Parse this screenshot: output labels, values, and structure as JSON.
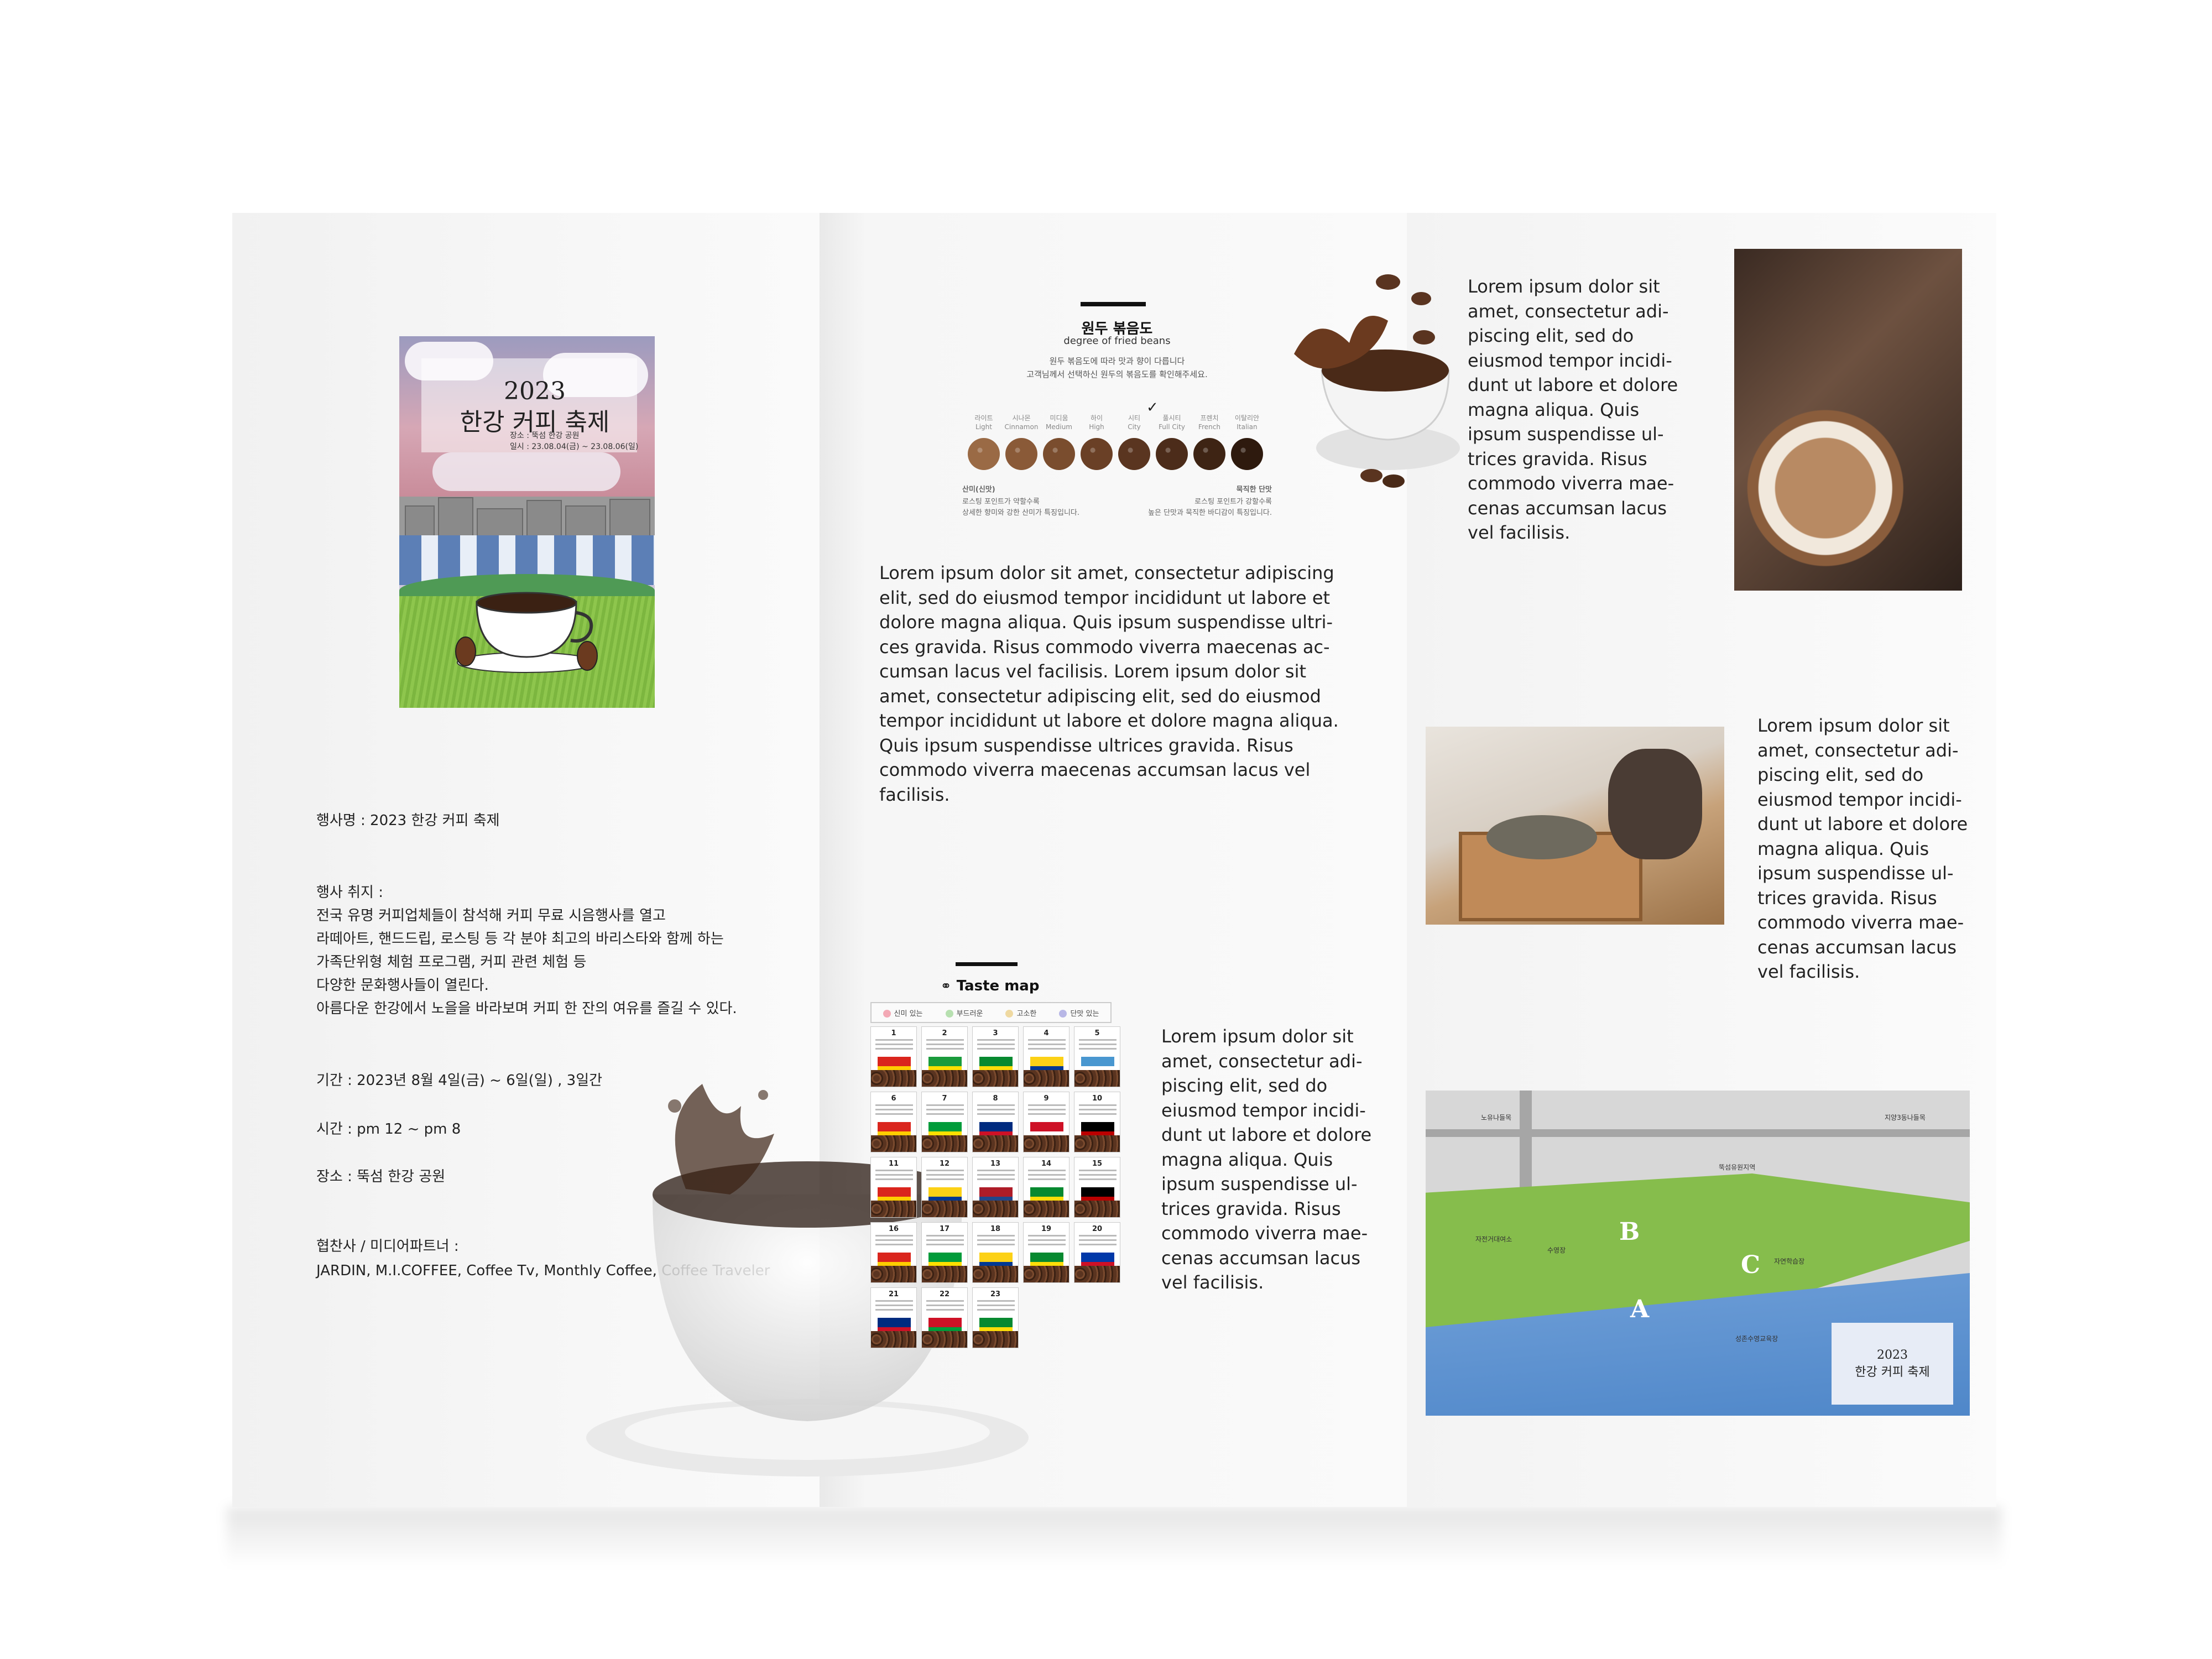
{
  "poster": {
    "title_line1": "2023",
    "title_line2": "한강 커피 축제",
    "sub_line1": "장소 : 뚝섬 한강 공원",
    "sub_line2": "일시 : 23.08.04(금) ~ 23.08.06(일)"
  },
  "event": {
    "name": "행사명 : 2023 한강 커피 축제",
    "purpose_heading": "행사 취지 :",
    "purpose_lines": [
      "전국 유명 커피업체들이 참석해 커피 무료 시음행사를 열고",
      "라떼아트, 핸드드립, 로스팅 등 각 분야 최고의 바리스타와 함께 하는",
      "가족단위형 체험 프로그램, 커피 관련 체험 등",
      "다양한 문화행사들이 열린다.",
      "아름다운 한강에서 노을을 바라보며 커피 한 잔의 여유를 즐길 수 있다."
    ],
    "period": "기간 : 2023년 8월 4일(금) ~ 6일(일) , 3일간",
    "time": "시간 : pm 12 ~ pm 8",
    "place": "장소 : 뚝섬 한강 공원",
    "sponsors_heading": "협찬사 / 미디어파트너 :",
    "sponsors": "JARDIN,  M.I.COFFEE,  Coffee Tv,  Monthly Coffee,  Coffee Traveler"
  },
  "roast": {
    "title": "원두 볶음도",
    "subtitle": "degree of fried beans",
    "desc1": "원두 볶음도에 따라 맛과 향이 다릅니다",
    "desc2": "고객님께서 선택하신 원두의 볶음도를 확인해주세요.",
    "levels": [
      {
        "ko": "라이트",
        "en": "Light",
        "color": "#9a6a45"
      },
      {
        "ko": "시나몬",
        "en": "Cinnamon",
        "color": "#8a5a38"
      },
      {
        "ko": "미디움",
        "en": "Medium",
        "color": "#7a4d2e"
      },
      {
        "ko": "하이",
        "en": "High",
        "color": "#6a4026"
      },
      {
        "ko": "시티",
        "en": "City",
        "color": "#5a3520"
      },
      {
        "ko": "풀시티",
        "en": "Full City",
        "color": "#4c2c1a"
      },
      {
        "ko": "프렌치",
        "en": "French",
        "color": "#3e2414"
      },
      {
        "ko": "이탈리안",
        "en": "Italian",
        "color": "#2e1a0e"
      }
    ],
    "check_mark": "✓",
    "foot_left_title": "산미(신맛)",
    "foot_left_1": "로스팅 포인트가 약할수록",
    "foot_left_2": "상세한 향미와 강한 산미가 특징입니다.",
    "foot_right_title": "묵직한 단맛",
    "foot_right_1": "로스팅 포인트가 강할수록",
    "foot_right_2": "높은 단맛과 묵직한 바디감이 특징입니다."
  },
  "mid_lorem": "Lorem ipsum dolor sit amet, consectetur adipiscing\nelit, sed do eiusmod tempor incididunt ut labore et\ndolore magna aliqua. Quis ipsum suspendisse ultri-\nces gravida. Risus commodo viverra maecenas ac-\ncumsan lacus vel facilisis. Lorem ipsum dolor sit\namet, consectetur adipiscing elit, sed do eiusmod\ntempor incididunt ut labore et dolore magna aliqua.\nQuis ipsum suspendisse ultrices gravida. Risus\ncommodo viverra maecenas accumsan lacus vel\nfacilisis.",
  "taste": {
    "title": "Taste map",
    "legend": [
      {
        "label": "신미 있는",
        "color": "#f3a9b5"
      },
      {
        "label": "부드러운",
        "color": "#b7e0b0"
      },
      {
        "label": "고소한",
        "color": "#efd9a1"
      },
      {
        "label": "단맛 있는",
        "color": "#b8b7e6"
      }
    ],
    "cards": [
      {
        "n": "1",
        "flag": [
          "#da251d",
          "#ffcd00"
        ]
      },
      {
        "n": "2",
        "flag": [
          "#1a9b3c",
          "#ffdf00"
        ]
      },
      {
        "n": "3",
        "flag": [
          "#078930",
          "#fcdd09"
        ]
      },
      {
        "n": "4",
        "flag": [
          "#fcd116",
          "#003893"
        ]
      },
      {
        "n": "5",
        "flag": [
          "#4997d0",
          "#ffffff"
        ]
      },
      {
        "n": "6",
        "flag": [
          "#da251d",
          "#ffcd00"
        ]
      },
      {
        "n": "7",
        "flag": [
          "#009b3a",
          "#fedf00"
        ]
      },
      {
        "n": "8",
        "flag": [
          "#002b7f",
          "#ce1126"
        ]
      },
      {
        "n": "9",
        "flag": [
          "#ce1126",
          "#ffffff"
        ]
      },
      {
        "n": "10",
        "flag": [
          "#000000",
          "#bb0000"
        ]
      },
      {
        "n": "11",
        "flag": [
          "#da251d",
          "#ffcd00"
        ]
      },
      {
        "n": "12",
        "flag": [
          "#fcd116",
          "#003893"
        ]
      },
      {
        "n": "13",
        "flag": [
          "#ae1c28",
          "#21468b"
        ]
      },
      {
        "n": "14",
        "flag": [
          "#078930",
          "#fcdd09"
        ]
      },
      {
        "n": "15",
        "flag": [
          "#000000",
          "#bb0000"
        ]
      },
      {
        "n": "16",
        "flag": [
          "#da251d",
          "#ffcd00"
        ]
      },
      {
        "n": "17",
        "flag": [
          "#009b3a",
          "#fedf00"
        ]
      },
      {
        "n": "18",
        "flag": [
          "#fcd116",
          "#003893"
        ]
      },
      {
        "n": "19",
        "flag": [
          "#078930",
          "#fcdd09"
        ]
      },
      {
        "n": "20",
        "flag": [
          "#0038a8",
          "#ce1126"
        ]
      },
      {
        "n": "21",
        "flag": [
          "#002b7f",
          "#ce1126"
        ]
      },
      {
        "n": "22",
        "flag": [
          "#ce1126",
          "#009b3a"
        ]
      },
      {
        "n": "23",
        "flag": [
          "#078930",
          "#fcdd09"
        ]
      }
    ]
  },
  "taste_lorem": "Lorem ipsum dolor sit\namet, consectetur adi-\npiscing elit, sed do\neiusmod tempor incidi-\ndunt ut labore et dolore\nmagna aliqua. Quis\nipsum suspendisse ul-\ntrices gravida. Risus\ncommodo viverra mae-\ncenas accumsan lacus\nvel facilisis.",
  "right_top_lorem": "Lorem ipsum dolor sit\namet, consectetur adi-\npiscing elit, sed do\neiusmod tempor incidi-\ndunt ut labore et dolore\nmagna aliqua. Quis\nipsum suspendisse ul-\ntrices gravida. Risus\ncommodo viverra mae-\ncenas accumsan lacus\nvel facilisis.",
  "right_mid_lorem": "Lorem ipsum dolor sit\namet, consectetur adi-\npiscing elit, sed do\neiusmod tempor incidi-\ndunt ut labore et dolore\nmagna aliqua. Quis\nipsum suspendisse ul-\ntrices gravida. Risus\ncommodo viverra mae-\ncenas accumsan lacus\nvel facilisis.",
  "map": {
    "zones": [
      "A",
      "B",
      "C"
    ],
    "labels": [
      "노유나들목",
      "지양3동나들목",
      "뚝섬유원지역",
      "자전거대여소",
      "수영장",
      "자연학습장",
      "성존수영교육장"
    ],
    "logo_year": "2023",
    "logo_title": "한강 커피 축제"
  }
}
